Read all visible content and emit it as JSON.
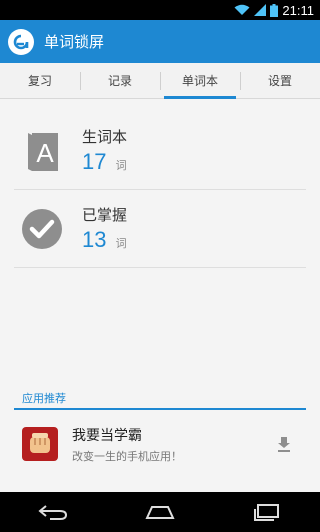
{
  "status_bar": {
    "time": "21:11",
    "icons": [
      "wifi-icon",
      "signal-icon",
      "battery-icon"
    ]
  },
  "app_bar": {
    "logo_icon": "app-logo-icon",
    "title": "单词锁屏"
  },
  "tabs": [
    {
      "label": "复习",
      "active": false
    },
    {
      "label": "记录",
      "active": false
    },
    {
      "label": "单词本",
      "active": true
    },
    {
      "label": "设置",
      "active": false
    }
  ],
  "stats": [
    {
      "icon": "vocabulary-book-icon",
      "label": "生词本",
      "count": "17",
      "unit": "词"
    },
    {
      "icon": "checkmark-circle-icon",
      "label": "已掌握",
      "count": "13",
      "unit": "词"
    }
  ],
  "recommendation": {
    "header": "应用推荐",
    "item": {
      "icon": "fist-app-icon",
      "name": "我要当学霸",
      "description": "改变一生的手机应用！",
      "action_icon": "download-icon"
    }
  },
  "nav_bar": {
    "buttons": [
      "back-icon",
      "home-icon",
      "recent-apps-icon"
    ]
  },
  "colors": {
    "accent": "#1e88d2",
    "background": "#f4f4f4",
    "rec_logo": "#b51f1f"
  }
}
